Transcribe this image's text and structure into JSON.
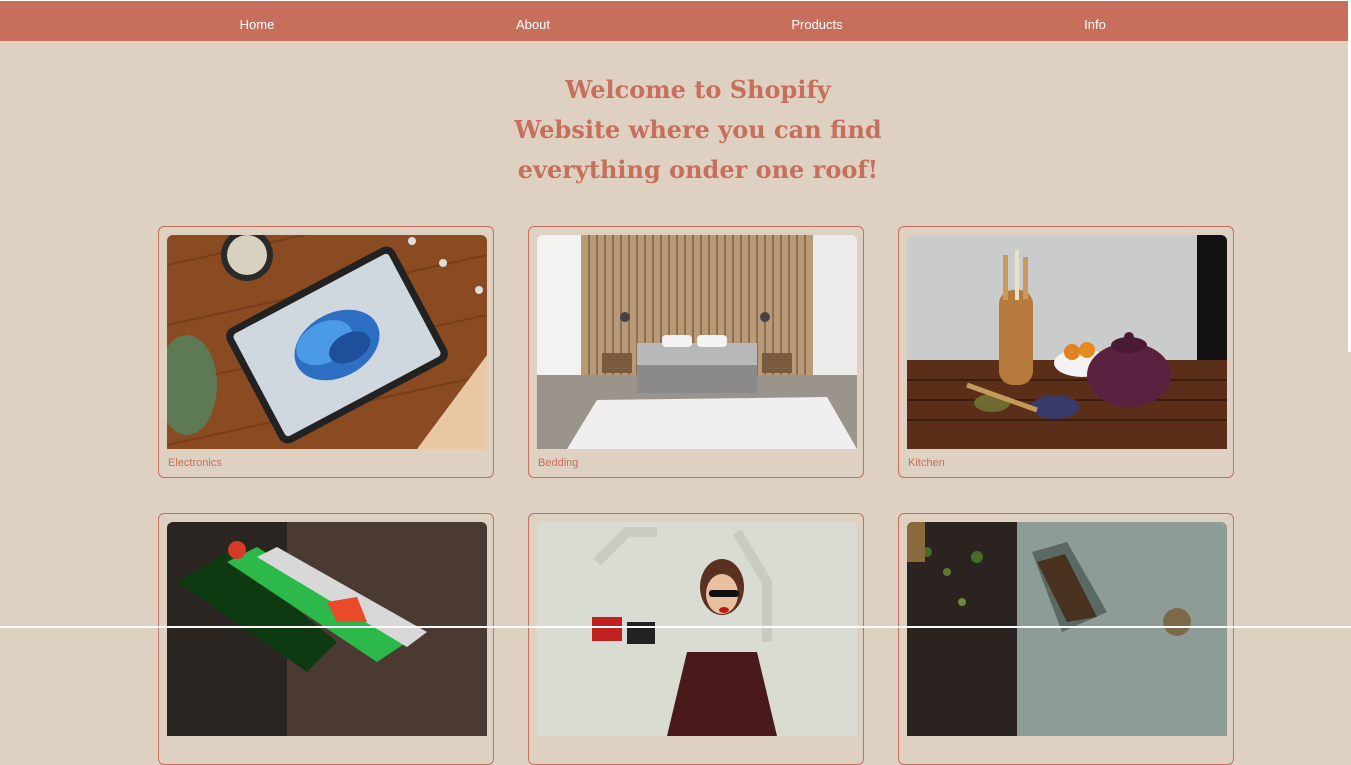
{
  "nav": {
    "items": [
      {
        "label": "Home"
      },
      {
        "label": "About"
      },
      {
        "label": "Products"
      },
      {
        "label": "Info"
      }
    ]
  },
  "hero": {
    "lines": [
      "Welcome to Shopify",
      "Website where you can find",
      "everything onder one roof!"
    ]
  },
  "categories": [
    {
      "label": "Electronics",
      "image": "tablet-on-desk-photo"
    },
    {
      "label": "Bedding",
      "image": "bedroom-photo"
    },
    {
      "label": "Kitchen",
      "image": "teapot-photo"
    },
    {
      "label": "",
      "image": "sports-gear-photo"
    },
    {
      "label": "",
      "image": "fashion-shopping-photo"
    },
    {
      "label": "",
      "image": "gardening-soil-photo"
    }
  ],
  "colors": {
    "accent": "#c56f5c",
    "background": "#dfd1c1",
    "nav_text": "#ffffff"
  }
}
